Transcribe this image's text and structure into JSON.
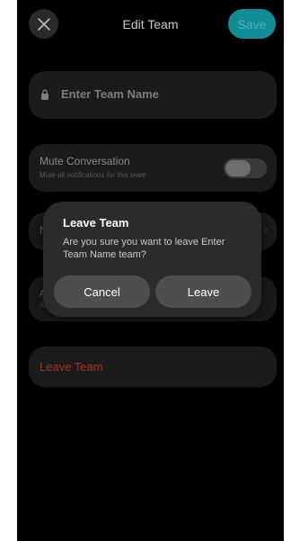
{
  "header": {
    "title": "Edit Team",
    "save_label": "Save",
    "close_icon": "close-icon"
  },
  "team_name": {
    "placeholder": "Enter Team Name",
    "icon": "lock-icon"
  },
  "mute": {
    "title": "Mute Conversation",
    "subtitle": "Mute all notifications for this team",
    "enabled": false
  },
  "obscured_rows": {
    "row1_letter": "N",
    "row2_letter": "A",
    "row2_sub_letter": "Al"
  },
  "leave": {
    "label": "Leave Team"
  },
  "dialog": {
    "title": "Leave Team",
    "message": "Are you sure you want to leave Enter Team Name team?",
    "cancel_label": "Cancel",
    "leave_label": "Leave"
  },
  "colors": {
    "accent": "#14a6b2",
    "danger": "#a8321c",
    "background": "#000000",
    "card": "#1b1b1d"
  }
}
